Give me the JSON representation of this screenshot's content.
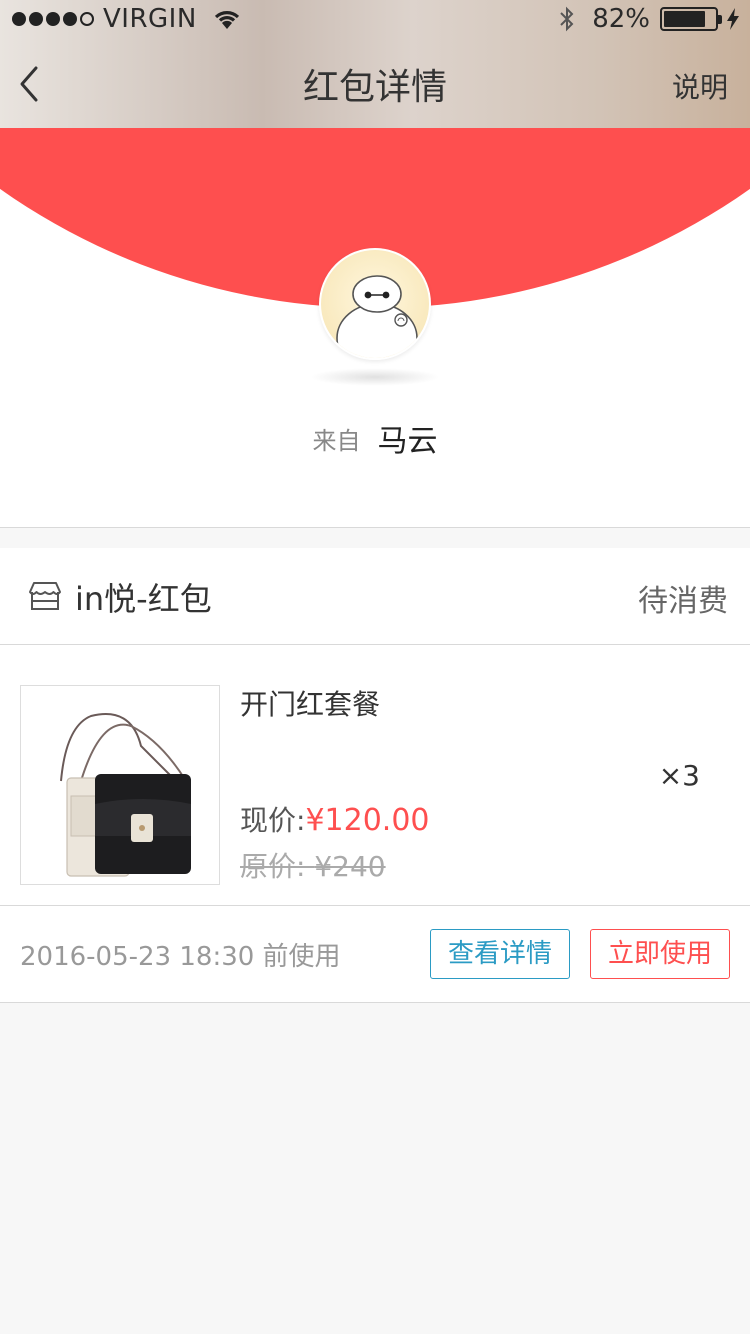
{
  "status_bar": {
    "carrier": "VIRGIN",
    "battery_percent_text": "82%",
    "battery_level": 0.82,
    "signal_bars_filled": 4,
    "signal_bars_total": 5
  },
  "nav": {
    "back_icon": "chevron-left-icon",
    "title": "红包详情",
    "help_label": "说明"
  },
  "banner": {
    "accent_color": "#fe4f4f",
    "from_label": "来自",
    "sender_name": "马云"
  },
  "card": {
    "shop_icon": "store-icon",
    "shop_name": "in悦-红包",
    "status": "待消费",
    "product": {
      "title": "开门红套餐",
      "quantity": "×3",
      "price_label": "现价:",
      "price_value": "¥120.00",
      "original_label": "原价: ",
      "original_value": "¥240"
    },
    "expire_text": "2016-05-23  18:30 前使用",
    "detail_button": "查看详情",
    "use_button": "立即使用"
  }
}
